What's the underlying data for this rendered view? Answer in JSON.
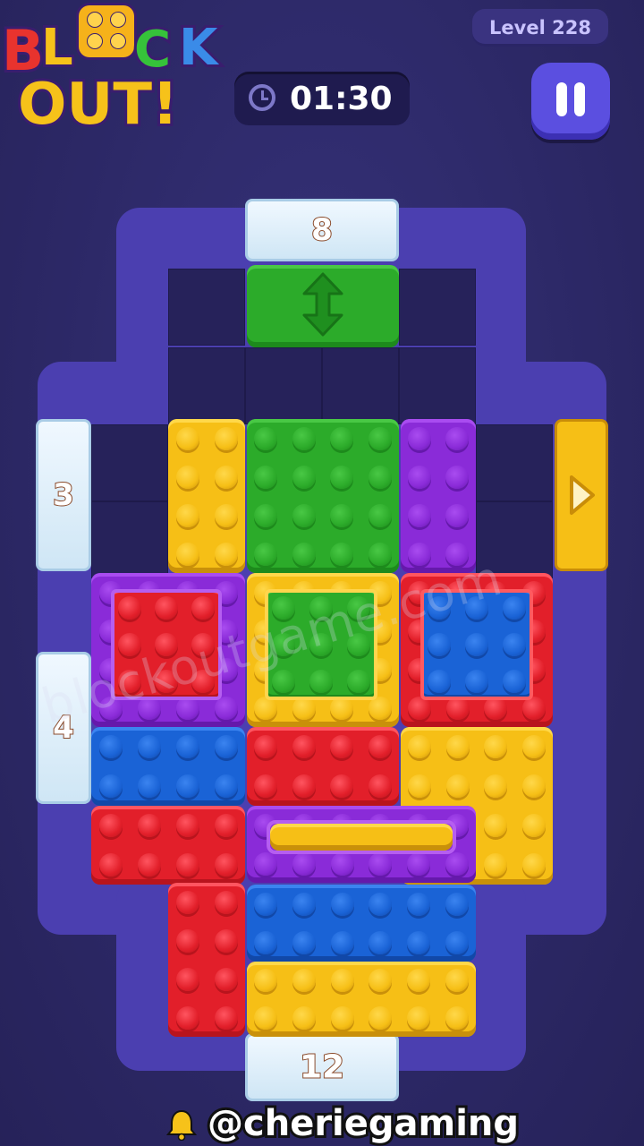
{
  "header": {
    "logo_line1": "BLOCK",
    "logo_line2": "OUT!",
    "level_label": "Level 228",
    "timer": "01:30",
    "timer_icon": "clock-icon",
    "pause_icon": "pause-icon"
  },
  "gates": {
    "top": "8",
    "left_upper": "3",
    "left_lower": "4",
    "bottom": "12",
    "right_icon": "arrow-right-icon"
  },
  "watermark": "blockoutgame.com",
  "credit": {
    "icon": "bell-icon",
    "handle": "@cheriegaming"
  },
  "colors": {
    "red": "#e21f2a",
    "green": "#2cab2a",
    "blue": "#1a63d6",
    "yellow": "#f6bf16",
    "purple": "#8a2bd8",
    "board": "#4b3fb0"
  }
}
